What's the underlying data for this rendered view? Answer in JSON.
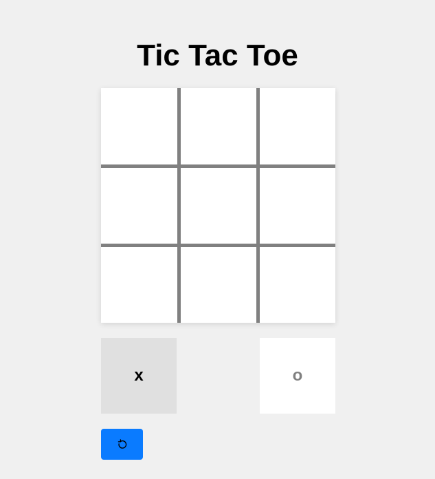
{
  "title": "Tic Tac Toe",
  "board": {
    "cells": [
      "",
      "",
      "",
      "",
      "",
      "",
      "",
      "",
      ""
    ]
  },
  "players": {
    "x": {
      "label": "x",
      "active": true
    },
    "o": {
      "label": "o",
      "active": false
    }
  },
  "reset_button": {
    "icon": "reset-icon"
  },
  "colors": {
    "background": "#f0f0f0",
    "grid_line": "#808080",
    "active_player_bg": "#e0e0e0",
    "inactive_player_text": "#808080",
    "accent": "#0a7bff"
  }
}
